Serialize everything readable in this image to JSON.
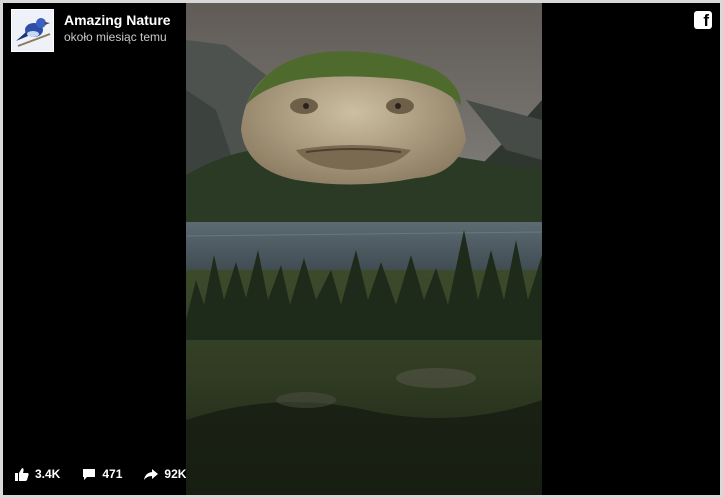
{
  "post": {
    "page_name": "Amazing Nature",
    "timestamp": "około miesiąc temu"
  },
  "header": {
    "icon": "facebook-icon"
  },
  "stats": {
    "likes": "3.4K",
    "comments": "471",
    "shares": "92K"
  },
  "colors": {
    "background": "#000000",
    "text": "#ffffff",
    "subtext": "#c9c9c9"
  }
}
